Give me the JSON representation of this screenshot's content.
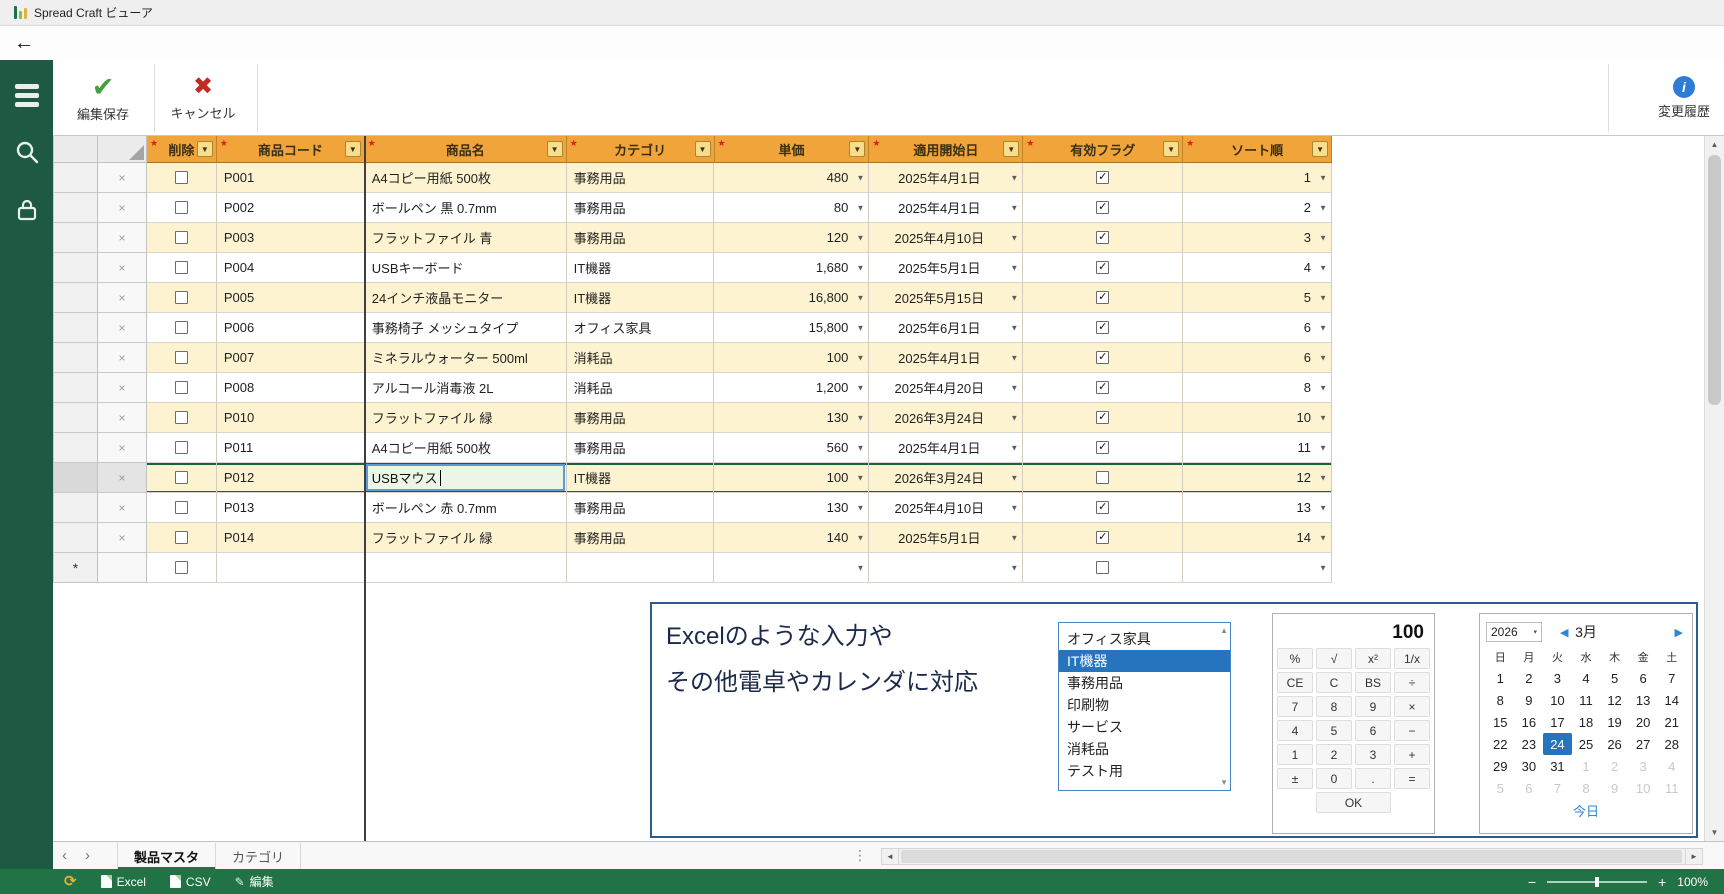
{
  "titlebar": {
    "title": "Spread Craft ビューア"
  },
  "toolbar": {
    "save_label": "編集保存",
    "cancel_label": "キャンセル",
    "history_label": "変更履歴",
    "info_glyph": "i"
  },
  "grid": {
    "columns": [
      "削除",
      "商品コード",
      "商品名",
      "カテゴリ",
      "単価",
      "適用開始日",
      "有効フラグ",
      "ソート順"
    ],
    "rows": [
      {
        "code": "P001",
        "name": "A4コピー用紙 500枚",
        "category": "事務用品",
        "price": "480",
        "date": "2025年4月1日",
        "active": true,
        "sort": "1"
      },
      {
        "code": "P002",
        "name": "ボールペン 黒 0.7mm",
        "category": "事務用品",
        "price": "80",
        "date": "2025年4月1日",
        "active": true,
        "sort": "2"
      },
      {
        "code": "P003",
        "name": "フラットファイル 青",
        "category": "事務用品",
        "price": "120",
        "date": "2025年4月10日",
        "active": true,
        "sort": "3"
      },
      {
        "code": "P004",
        "name": "USBキーボード",
        "category": "IT機器",
        "price": "1,680",
        "date": "2025年5月1日",
        "active": true,
        "sort": "4"
      },
      {
        "code": "P005",
        "name": "24インチ液晶モニター",
        "category": "IT機器",
        "price": "16,800",
        "date": "2025年5月15日",
        "active": true,
        "sort": "5"
      },
      {
        "code": "P006",
        "name": "事務椅子 メッシュタイプ",
        "category": "オフィス家具",
        "price": "15,800",
        "date": "2025年6月1日",
        "active": true,
        "sort": "6"
      },
      {
        "code": "P007",
        "name": "ミネラルウォーター 500ml",
        "category": "消耗品",
        "price": "100",
        "date": "2025年4月1日",
        "active": true,
        "sort": "6"
      },
      {
        "code": "P008",
        "name": "アルコール消毒液 2L",
        "category": "消耗品",
        "price": "1,200",
        "date": "2025年4月20日",
        "active": true,
        "sort": "8"
      },
      {
        "code": "P010",
        "name": "フラットファイル 緑",
        "category": "事務用品",
        "price": "130",
        "date": "2026年3月24日",
        "active": true,
        "sort": "10"
      },
      {
        "code": "P011",
        "name": "A4コピー用紙 500枚",
        "category": "事務用品",
        "price": "560",
        "date": "2025年4月1日",
        "active": true,
        "sort": "11"
      },
      {
        "code": "P012",
        "name": "USBマウス",
        "category": "IT機器",
        "price": "100",
        "date": "2026年3月24日",
        "active": false,
        "sort": "12",
        "editing": true
      },
      {
        "code": "P013",
        "name": "ボールペン 赤 0.7mm",
        "category": "事務用品",
        "price": "130",
        "date": "2025年4月10日",
        "active": true,
        "sort": "13"
      },
      {
        "code": "P014",
        "name": "フラットファイル 緑",
        "category": "事務用品",
        "price": "140",
        "date": "2025年5月1日",
        "active": true,
        "sort": "14"
      }
    ]
  },
  "annotation": {
    "line1": "Excelのような入力や",
    "line2": "その他電卓やカレンダに対応",
    "listbox": {
      "items": [
        "オフィス家具",
        "IT機器",
        "事務用品",
        "印刷物",
        "サービス",
        "消耗品",
        "テスト用"
      ],
      "selected": "IT機器"
    },
    "calculator": {
      "display": "100",
      "keys": [
        "%",
        "√",
        "x²",
        "1/x",
        "CE",
        "C",
        "BS",
        "÷",
        "7",
        "8",
        "9",
        "×",
        "4",
        "5",
        "6",
        "−",
        "1",
        "2",
        "3",
        "+",
        "±",
        "0",
        ".",
        "="
      ],
      "ok_label": "OK"
    },
    "calendar": {
      "year": "2026",
      "month": "3月",
      "weekdays": [
        "日",
        "月",
        "火",
        "水",
        "木",
        "金",
        "土"
      ],
      "weeks": [
        [
          "1",
          "2",
          "3",
          "4",
          "5",
          "6",
          "7"
        ],
        [
          "8",
          "9",
          "10",
          "11",
          "12",
          "13",
          "14"
        ],
        [
          "15",
          "16",
          "17",
          "18",
          "19",
          "20",
          "21"
        ],
        [
          "22",
          "23",
          "24",
          "25",
          "26",
          "27",
          "28"
        ],
        [
          "29",
          "30",
          "31",
          "1",
          "2",
          "3",
          "4"
        ],
        [
          "5",
          "6",
          "7",
          "8",
          "9",
          "10",
          "11"
        ]
      ],
      "selected_day": "24",
      "today_label": "今日"
    }
  },
  "tabbar": {
    "tabs": [
      {
        "label": "製品マスタ",
        "active": true
      },
      {
        "label": "カテゴリ",
        "active": false
      }
    ]
  },
  "statusbar": {
    "excel_label": "Excel",
    "csv_label": "CSV",
    "edit_label": "編集",
    "zoom_value": "100%"
  },
  "glyphs": {
    "back_arrow": "←",
    "check": "✔",
    "check_small": "✓",
    "cross": "✖",
    "star": "★",
    "filter_arrow": "▼",
    "cell_arrow": "▼",
    "row_x": "×",
    "new_row": "*",
    "up": "▲",
    "down": "▼",
    "left": "◄",
    "right": "►",
    "tab_prev": "‹",
    "tab_next": "›",
    "dots": "⋮",
    "cal_prev": "◀",
    "cal_next": "▶",
    "caret_down": "▾",
    "refresh": "⟳",
    "pencil": "✎",
    "minus": "−",
    "plus": "+"
  }
}
